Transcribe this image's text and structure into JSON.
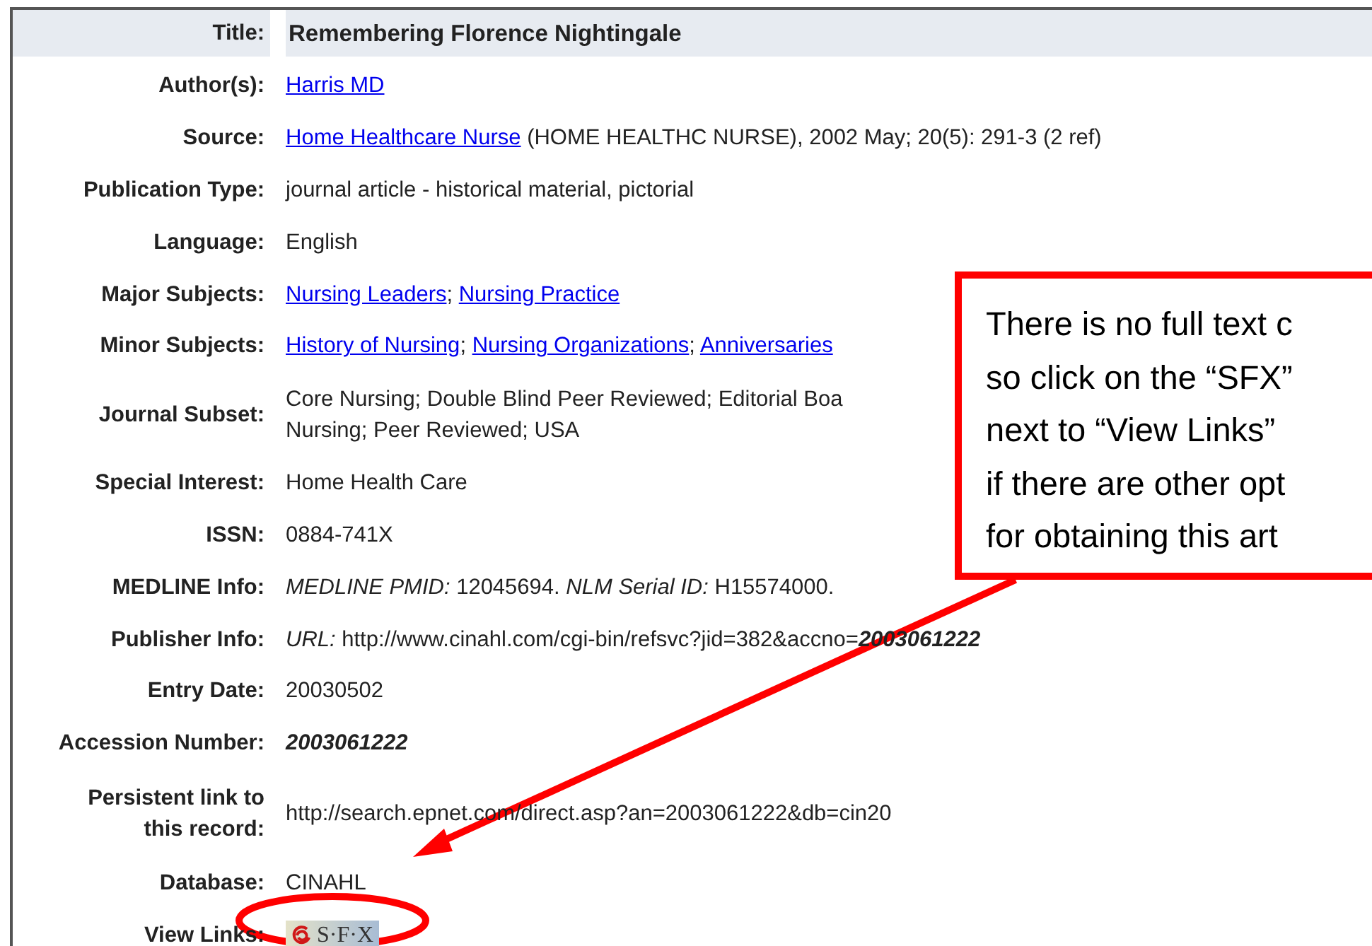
{
  "record": [
    {
      "label": "Title:",
      "kind": "title",
      "value": [
        {
          "kind": "bold",
          "text": "Remembering Florence Nightingale"
        }
      ]
    },
    {
      "label": "Author(s):",
      "kind": "field",
      "value": [
        {
          "kind": "link",
          "text": "Harris MD"
        }
      ]
    },
    {
      "label": "Source:",
      "kind": "field",
      "value": [
        {
          "kind": "link",
          "text": "Home Healthcare Nurse"
        },
        {
          "kind": "text",
          "text": " (HOME HEALTHC NURSE), 2002 May; 20(5): 291-3 (2 ref)"
        }
      ]
    },
    {
      "label": "Publication Type:",
      "kind": "field",
      "value": [
        {
          "kind": "text",
          "text": "journal article - historical material, pictorial"
        }
      ]
    },
    {
      "label": "Language:",
      "kind": "field",
      "value": [
        {
          "kind": "text",
          "text": "English"
        }
      ]
    },
    {
      "label": "Major Subjects:",
      "kind": "field",
      "value": [
        {
          "kind": "link",
          "text": "Nursing Leaders"
        },
        {
          "kind": "text",
          "text": "; "
        },
        {
          "kind": "link",
          "text": "Nursing Practice"
        }
      ]
    },
    {
      "label": "Minor Subjects:",
      "kind": "field",
      "value": [
        {
          "kind": "link",
          "text": "History of Nursing"
        },
        {
          "kind": "text",
          "text": "; "
        },
        {
          "kind": "link",
          "text": "Nursing Organizations"
        },
        {
          "kind": "text",
          "text": "; "
        },
        {
          "kind": "link",
          "text": "Anniversaries"
        }
      ]
    },
    {
      "label": "Journal Subset:",
      "kind": "multiline",
      "lines": [
        "Core Nursing; Double Blind Peer Reviewed; Editorial Boa",
        "Nursing; Peer Reviewed; USA"
      ]
    },
    {
      "label": "Special Interest:",
      "kind": "field",
      "value": [
        {
          "kind": "text",
          "text": "Home Health Care"
        }
      ]
    },
    {
      "label": "ISSN:",
      "kind": "field",
      "value": [
        {
          "kind": "text",
          "text": "0884-741X"
        }
      ]
    },
    {
      "label": "MEDLINE Info:",
      "kind": "field",
      "value": [
        {
          "kind": "italic",
          "text": "MEDLINE PMID:"
        },
        {
          "kind": "text",
          "text": " 12045694. "
        },
        {
          "kind": "italic",
          "text": "NLM Serial ID:"
        },
        {
          "kind": "text",
          "text": " H15574000."
        }
      ]
    },
    {
      "label": "Publisher Info:",
      "kind": "field",
      "value": [
        {
          "kind": "italic",
          "text": "URL:"
        },
        {
          "kind": "text",
          "text": " http://www.cinahl.com/cgi-bin/refsvc?jid=382&accno="
        },
        {
          "kind": "bold_italic",
          "text": "2003061222"
        }
      ]
    },
    {
      "label": "Entry Date:",
      "kind": "field",
      "value": [
        {
          "kind": "text",
          "text": "20030502"
        }
      ]
    },
    {
      "label": "Accession Number:",
      "kind": "field",
      "value": [
        {
          "kind": "bold_italic",
          "text": "2003061222"
        }
      ]
    },
    {
      "label": "Persistent link to this record:",
      "kind": "field",
      "value": [
        {
          "kind": "text",
          "text": "http://search.epnet.com/direct.asp?an=2003061222&db=cin20"
        }
      ]
    },
    {
      "label": "Database:",
      "kind": "field",
      "value": [
        {
          "kind": "text",
          "text": "CINAHL"
        }
      ]
    },
    {
      "label": "View Links:",
      "kind": "sfx",
      "button": "S·F·X"
    }
  ],
  "callout": {
    "lines": [
      "There is no full text c",
      "so click on the “SFX”",
      "next to “View Links”",
      "if there are other opt",
      "for obtaining this art"
    ]
  }
}
